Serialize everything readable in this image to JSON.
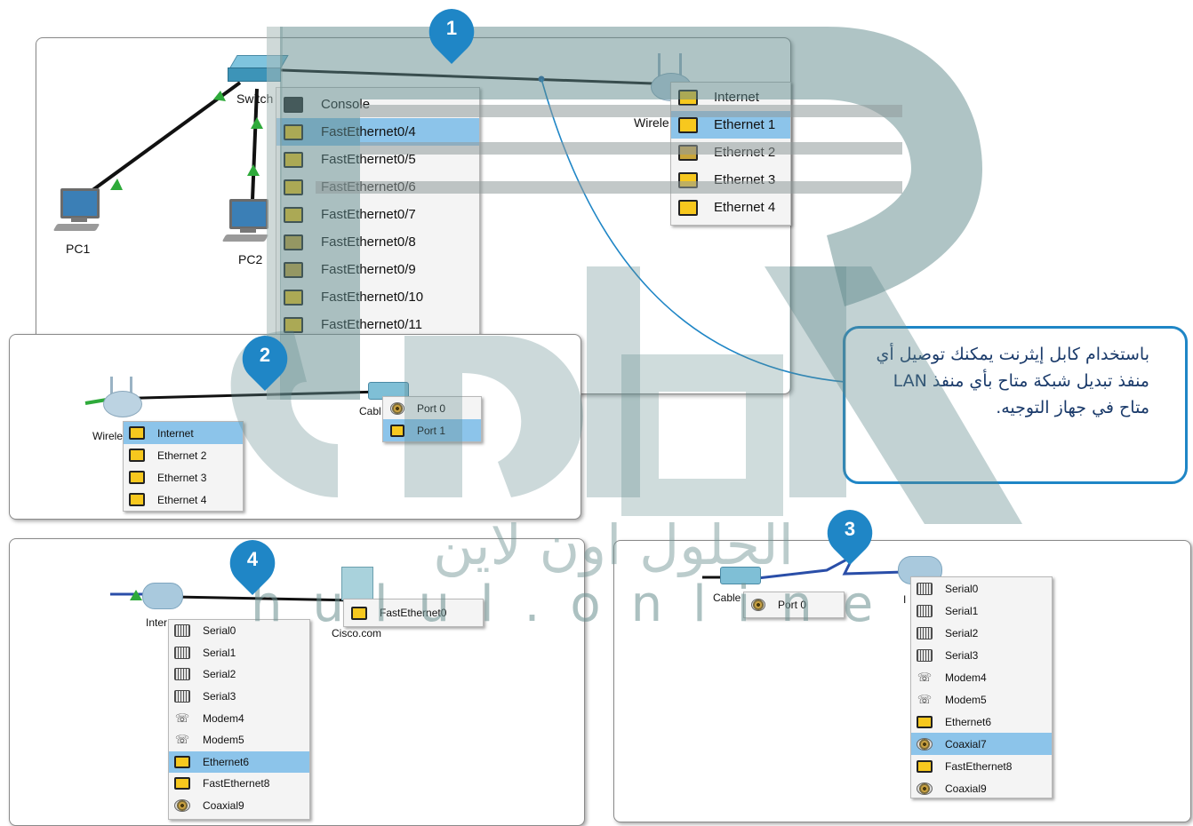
{
  "badges": {
    "b1": "1",
    "b2": "2",
    "b3": "3",
    "b4": "4"
  },
  "callout": {
    "text": "باستخدام كابل إيثرنت يمكنك توصيل أي منفذ تبديل شبكة متاح بأي منفذ LAN متاح في جهاز التوجيه."
  },
  "watermark": {
    "text": "hulul.online"
  },
  "panel1": {
    "devices": {
      "switch": "Switch",
      "pc1": "PC1",
      "pc2": "PC2",
      "wireless": "Wirele"
    },
    "switch_menu": [
      {
        "label": "Console",
        "icon": "console-port-icon"
      },
      {
        "label": "FastEthernet0/4",
        "icon": "ethernet-port-icon",
        "selected": true
      },
      {
        "label": "FastEthernet0/5",
        "icon": "ethernet-port-icon"
      },
      {
        "label": "FastEthernet0/6",
        "icon": "ethernet-port-icon"
      },
      {
        "label": "FastEthernet0/7",
        "icon": "ethernet-port-icon"
      },
      {
        "label": "FastEthernet0/8",
        "icon": "ethernet-port-icon"
      },
      {
        "label": "FastEthernet0/9",
        "icon": "ethernet-port-icon"
      },
      {
        "label": "FastEthernet0/10",
        "icon": "ethernet-port-icon"
      },
      {
        "label": "FastEthernet0/11",
        "icon": "ethernet-port-icon"
      }
    ],
    "router_menu": [
      {
        "label": "Internet"
      },
      {
        "label": "Ethernet 1",
        "selected": true
      },
      {
        "label": "Ethernet 2"
      },
      {
        "label": "Ethernet 3"
      },
      {
        "label": "Ethernet 4"
      }
    ]
  },
  "panel2": {
    "devices": {
      "wireless": "Wirele",
      "cable": "Cabl"
    },
    "router_menu": [
      {
        "label": "Internet",
        "selected": true
      },
      {
        "label": "Ethernet 2"
      },
      {
        "label": "Ethernet 3"
      },
      {
        "label": "Ethernet 4"
      }
    ],
    "modem_menu": [
      {
        "label": "Port 0",
        "icon": "coaxial-port-icon"
      },
      {
        "label": "Port 1",
        "icon": "ethernet-port-icon",
        "selected": true
      }
    ]
  },
  "panel3": {
    "devices": {
      "cable": "Cable",
      "internet": "I"
    },
    "port_menu": [
      {
        "label": "Port 0",
        "icon": "coaxial-port-icon"
      }
    ],
    "cloud_menu": [
      {
        "label": "Serial0",
        "icon": "serial-port-icon"
      },
      {
        "label": "Serial1",
        "icon": "serial-port-icon"
      },
      {
        "label": "Serial2",
        "icon": "serial-port-icon"
      },
      {
        "label": "Serial3",
        "icon": "serial-port-icon"
      },
      {
        "label": "Modem4",
        "icon": "modem-port-icon"
      },
      {
        "label": "Modem5",
        "icon": "modem-port-icon"
      },
      {
        "label": "Ethernet6",
        "icon": "ethernet-port-icon"
      },
      {
        "label": "Coaxial7",
        "icon": "coaxial-port-icon",
        "selected": true
      },
      {
        "label": "FastEthernet8",
        "icon": "ethernet-port-icon"
      },
      {
        "label": "Coaxial9",
        "icon": "coaxial-port-icon"
      }
    ]
  },
  "panel4": {
    "devices": {
      "internet": "Inter",
      "server": "Cisco.com"
    },
    "server_menu": [
      {
        "label": "FastEthernet0",
        "icon": "ethernet-port-icon"
      }
    ],
    "cloud_menu": [
      {
        "label": "Serial0",
        "icon": "serial-port-icon"
      },
      {
        "label": "Serial1",
        "icon": "serial-port-icon"
      },
      {
        "label": "Serial2",
        "icon": "serial-port-icon"
      },
      {
        "label": "Serial3",
        "icon": "serial-port-icon"
      },
      {
        "label": "Modem4",
        "icon": "modem-port-icon"
      },
      {
        "label": "Modem5",
        "icon": "modem-port-icon"
      },
      {
        "label": "Ethernet6",
        "icon": "ethernet-port-icon",
        "selected": true
      },
      {
        "label": "FastEthernet8",
        "icon": "ethernet-port-icon"
      },
      {
        "label": "Coaxial9",
        "icon": "coaxial-port-icon"
      }
    ]
  },
  "colors": {
    "badge": "#1f86c6",
    "callout_border": "#1f86c6",
    "selection": "#8cc4ea",
    "ethernet_port": "#f7c81e",
    "watermark": "#5f8a8b"
  }
}
